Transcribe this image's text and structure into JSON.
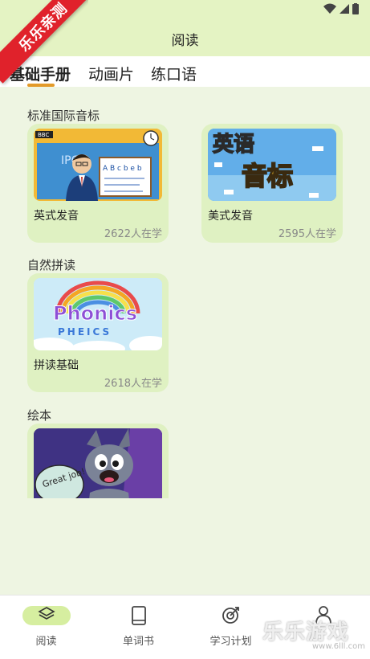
{
  "badge": "乐乐亲测",
  "header": {
    "title": "阅读"
  },
  "tabs": [
    {
      "label": "基础手册"
    },
    {
      "label": "动画片"
    },
    {
      "label": "练口语"
    }
  ],
  "sections": [
    {
      "title": "标准国际音标",
      "cards": [
        {
          "name": "英式发音",
          "count": "2622人在学",
          "thumb_text": {
            "bbc": "BBC",
            "ipc": "IPC",
            "abc": "A B c b e b"
          }
        },
        {
          "name": "美式发音",
          "count": "2595人在学",
          "thumb_text": {
            "line1": "英语",
            "line2": "音标"
          }
        }
      ]
    },
    {
      "title": "自然拼读",
      "cards": [
        {
          "name": "拼读基础",
          "count": "2618人在学",
          "thumb_text": {
            "line1": "Phonics",
            "line2": "PHEICS"
          }
        }
      ]
    },
    {
      "title": "绘本",
      "cards": [
        {
          "name": "",
          "count": "",
          "thumb_text": {
            "bubble": "Great job!"
          }
        }
      ]
    }
  ],
  "bottom_nav": [
    {
      "label": "阅读",
      "icon": "layers-icon",
      "active": true
    },
    {
      "label": "单词书",
      "icon": "book-icon",
      "active": false
    },
    {
      "label": "学习计划",
      "icon": "target-icon",
      "active": false
    },
    {
      "label": "",
      "icon": "person-icon",
      "active": false
    }
  ],
  "watermark": {
    "big": "乐乐游戏",
    "small": "www.6lll.com"
  },
  "colors": {
    "accent": "#e39a29",
    "header_bg": "#e4f3c3",
    "card_bg": "#dff1c2",
    "page_bg": "#eef5e2",
    "badge": "#e0222b"
  }
}
